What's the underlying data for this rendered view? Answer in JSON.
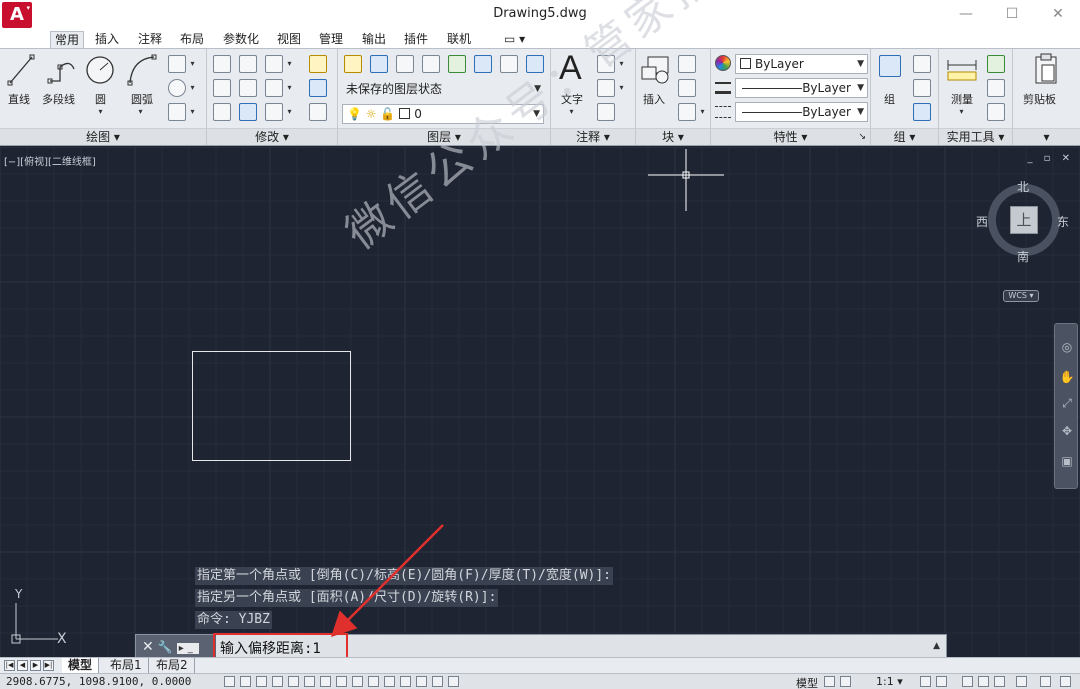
{
  "window": {
    "title": "Drawing5.dwg",
    "app_logo": "A",
    "minimize": "—",
    "maximize": "☐",
    "close": "✕"
  },
  "tabs": [
    "常用",
    "插入",
    "注释",
    "布局",
    "参数化",
    "视图",
    "管理",
    "输出",
    "插件",
    "联机"
  ],
  "tabs_extra": "▭ ▾",
  "ribbon": {
    "draw": {
      "title": "绘图 ▾",
      "line": "直线",
      "polyline": "多段线",
      "circle": "圆",
      "arc": "圆弧"
    },
    "modify": {
      "title": "修改 ▾"
    },
    "layers": {
      "title": "图层 ▾",
      "layer_state": "未保存的图层状态",
      "current_layer": "0"
    },
    "annotation": {
      "title": "注释 ▾",
      "text": "文字",
      "text_glyph": "A"
    },
    "block": {
      "title": "块 ▾",
      "insert": "插入"
    },
    "properties": {
      "title": "特性 ▾",
      "color": "ByLayer",
      "linetype": "ByLayer",
      "lineweight": "ByLayer",
      "launcher": "↘"
    },
    "groups": {
      "title": "组 ▾",
      "group": "组"
    },
    "utilities": {
      "title": "实用工具 ▾",
      "measure": "测量"
    },
    "clipboard": {
      "title": "▾",
      "paste": "剪贴板"
    }
  },
  "viewport": {
    "label": "[−][俯视][二维线框]",
    "controls": "_ ▫ ✕",
    "viewcube": {
      "top": "上",
      "north": "北",
      "south": "南",
      "east": "东",
      "west": "西",
      "wcs": "WCS ▾"
    },
    "watermark": "微信公众号：管家插件",
    "ucs_x": "X",
    "ucs_y": "Y"
  },
  "command": {
    "history": [
      "指定第一个角点或 [倒角(C)/标高(E)/圆角(F)/厚度(T)/宽度(W)]:",
      "指定另一个角点或 [面积(A)/尺寸(D)/旋转(R)]:",
      "命令: YJBZ"
    ],
    "current_prompt": "输入偏移距离:1",
    "tools": "✕ 🔧",
    "scroll": "▲"
  },
  "layout_tabs": [
    "模型",
    "布局1",
    "布局2"
  ],
  "status": {
    "coords": "2908.6775, 1098.9100, 0.0000",
    "model": "模型",
    "scale": "1:1 ▾"
  },
  "colors": {
    "viewport_bg": "#1e2431",
    "ribbon_bg": "#e8ebef",
    "highlight": "#e0302d"
  }
}
